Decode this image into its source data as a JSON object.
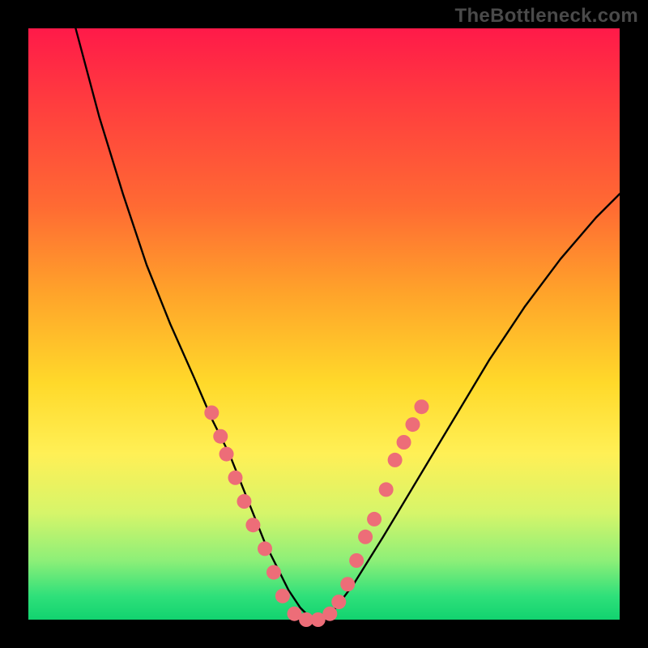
{
  "watermark_text": "TheBottleneck.com",
  "colors": {
    "page_bg": "#000000",
    "watermark": "#4a4a4a",
    "curve": "#000000",
    "marker_fill": "#ed6d78",
    "marker_stroke": "#c94f5c"
  },
  "chart_data": {
    "type": "line",
    "title": "",
    "xlabel": "",
    "ylabel": "",
    "xlim": [
      0,
      100
    ],
    "ylim": [
      0,
      100
    ],
    "grid": false,
    "legend": false,
    "series": [
      {
        "name": "bottleneck-curve",
        "x": [
          8,
          12,
          16,
          20,
          24,
          28,
          31,
          34,
          36,
          38,
          40,
          42,
          44,
          46,
          48,
          50,
          52,
          55,
          60,
          66,
          72,
          78,
          84,
          90,
          96,
          100
        ],
        "y": [
          100,
          85,
          72,
          60,
          50,
          41,
          34,
          28,
          23,
          18,
          13,
          9,
          5,
          2,
          0,
          0,
          2,
          6,
          14,
          24,
          34,
          44,
          53,
          61,
          68,
          72
        ]
      }
    ],
    "markers": [
      {
        "x": 31.0,
        "y": 35.0
      },
      {
        "x": 32.5,
        "y": 31.0
      },
      {
        "x": 33.5,
        "y": 28.0
      },
      {
        "x": 35.0,
        "y": 24.0
      },
      {
        "x": 36.5,
        "y": 20.0
      },
      {
        "x": 38.0,
        "y": 16.0
      },
      {
        "x": 40.0,
        "y": 12.0
      },
      {
        "x": 41.5,
        "y": 8.0
      },
      {
        "x": 43.0,
        "y": 4.0
      },
      {
        "x": 45.0,
        "y": 1.0
      },
      {
        "x": 47.0,
        "y": 0.0
      },
      {
        "x": 49.0,
        "y": 0.0
      },
      {
        "x": 51.0,
        "y": 1.0
      },
      {
        "x": 52.5,
        "y": 3.0
      },
      {
        "x": 54.0,
        "y": 6.0
      },
      {
        "x": 55.5,
        "y": 10.0
      },
      {
        "x": 57.0,
        "y": 14.0
      },
      {
        "x": 58.5,
        "y": 17.0
      },
      {
        "x": 60.5,
        "y": 22.0
      },
      {
        "x": 62.0,
        "y": 27.0
      },
      {
        "x": 63.5,
        "y": 30.0
      },
      {
        "x": 65.0,
        "y": 33.0
      },
      {
        "x": 66.5,
        "y": 36.0
      }
    ]
  }
}
